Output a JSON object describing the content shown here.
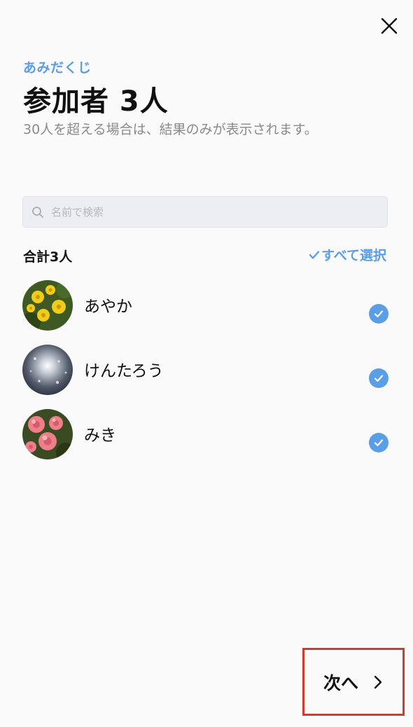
{
  "header": {
    "eyebrow": "あみだくじ",
    "title": "参加者 3人",
    "subtitle": "30人を超える場合は、結果のみが表示されます。"
  },
  "search": {
    "placeholder": "名前で検索"
  },
  "list": {
    "total_label": "合計3人",
    "select_all_label": "すべて選択",
    "members": [
      {
        "name": "あやか",
        "selected": true
      },
      {
        "name": "けんたろう",
        "selected": true
      },
      {
        "name": "みき",
        "selected": true
      }
    ]
  },
  "footer": {
    "next_label": "次へ"
  },
  "colors": {
    "accent": "#5b9ee8",
    "highlight_border": "#d9382c"
  },
  "icons": {
    "close": "close-icon",
    "search": "search-icon",
    "select_all": "check-icon",
    "member_check": "check-circle-icon",
    "next": "chevron-right-icon"
  }
}
